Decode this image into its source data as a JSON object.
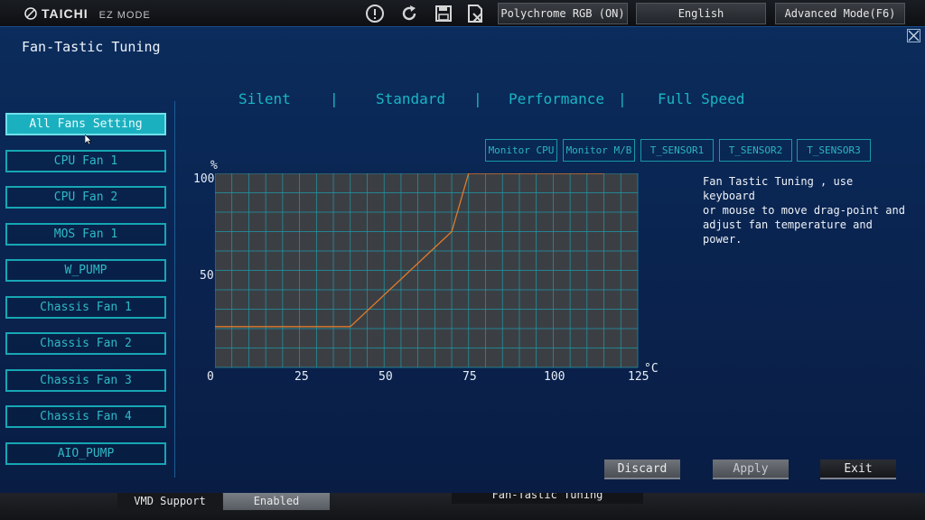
{
  "topbar": {
    "brand": "TAICHI",
    "mode": "EZ MODE",
    "icons": [
      "info-icon",
      "refresh-icon",
      "save-icon",
      "discard-icon"
    ],
    "buttons": {
      "rgb": "Polychrome RGB (ON)",
      "language": "English",
      "advanced": "Advanced Mode(F6)"
    }
  },
  "dialog": {
    "title": "Fan-Tastic Tuning",
    "tabs": [
      "Silent",
      "Standard",
      "Performance",
      "Full Speed"
    ],
    "fans": [
      "All Fans Setting",
      "CPU Fan 1",
      "CPU Fan 2",
      "MOS Fan 1",
      "W_PUMP",
      "Chassis Fan 1",
      "Chassis Fan 2",
      "Chassis Fan 3",
      "Chassis Fan 4",
      "AIO_PUMP"
    ],
    "selected_fan": "All Fans Setting",
    "monitors": [
      "Monitor CPU",
      "Monitor M/B",
      "T_SENSOR1",
      "T_SENSOR2",
      "T_SENSOR3"
    ],
    "help": "Fan Tastic Tuning , use keyboard\nor mouse to move drag-point and\nadjust fan temperature and power.",
    "actions": {
      "discard": "Discard",
      "apply": "Apply",
      "exit": "Exit"
    }
  },
  "chart_data": {
    "type": "line",
    "xlabel": "°C",
    "ylabel": "%",
    "xlim": [
      0,
      125
    ],
    "ylim": [
      0,
      100
    ],
    "x_ticks": [
      "0",
      "25",
      "50",
      "75",
      "100",
      "125"
    ],
    "y_ticks": [
      "100",
      "50"
    ],
    "series": [
      {
        "x": [
          0,
          40,
          70,
          75,
          115
        ],
        "y": [
          21,
          21,
          70,
          100,
          100
        ]
      }
    ],
    "colors": {
      "line": "#e07a2a",
      "grid": "#1f9aa8",
      "plot_bg": "#3b3f44"
    }
  },
  "under": {
    "left_label": "VMD Support",
    "left_value": "Enabled",
    "right_label": "Fan-Tastic Tuning"
  }
}
